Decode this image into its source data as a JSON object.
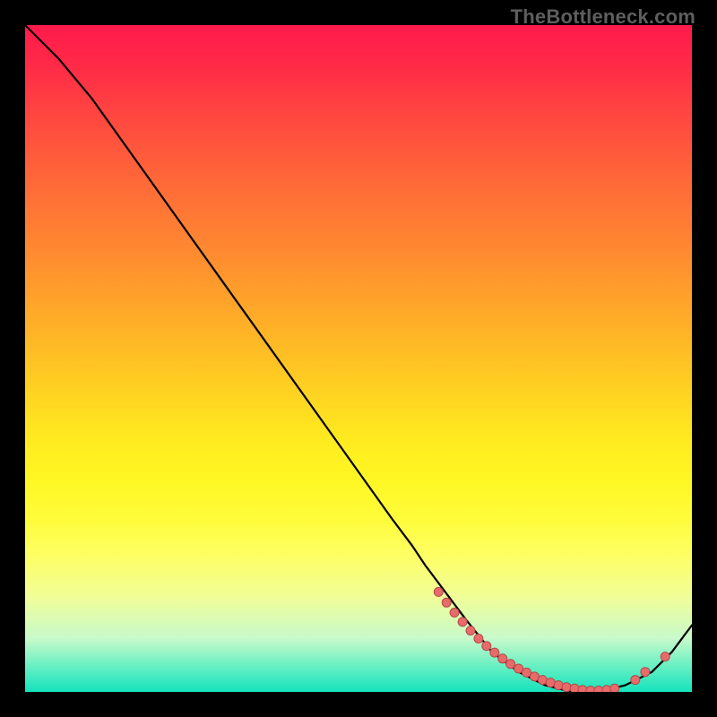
{
  "watermark": {
    "text": "TheBottleneck.com"
  },
  "colors": {
    "background": "#000000",
    "curve_stroke": "#000000",
    "dot_fill": "#e86b6b",
    "dot_stroke": "#b54848"
  },
  "chart_data": {
    "type": "line",
    "title": "",
    "xlabel": "",
    "ylabel": "",
    "xlim": [
      0,
      100
    ],
    "ylim": [
      0,
      100
    ],
    "grid": false,
    "series": [
      {
        "name": "bottleneck-curve",
        "x": [
          0,
          5,
          10,
          15,
          20,
          25,
          30,
          35,
          40,
          45,
          50,
          55,
          58,
          60,
          63,
          66,
          70,
          74,
          78,
          82,
          86,
          90,
          94,
          97,
          100
        ],
        "y": [
          100,
          95,
          89,
          82,
          75,
          68,
          61,
          54,
          47,
          40,
          33,
          26,
          22,
          19,
          15,
          11,
          6,
          3,
          1,
          0,
          0,
          1,
          3,
          6,
          10
        ]
      }
    ],
    "marker_groups": [
      {
        "name": "dense-cluster-left",
        "x": [
          62,
          63.2,
          64.4,
          65.6,
          66.8,
          68,
          69.2,
          70.4,
          71.6,
          72.8,
          74,
          75.2,
          76.4,
          77.6,
          78.8,
          80,
          81.2,
          82.4,
          83.6,
          84.8,
          86,
          87.2,
          88.4
        ],
        "y": [
          15,
          13.4,
          11.9,
          10.5,
          9.2,
          8,
          6.9,
          5.9,
          5.0,
          4.2,
          3.5,
          2.9,
          2.3,
          1.8,
          1.4,
          1.0,
          0.7,
          0.5,
          0.3,
          0.2,
          0.2,
          0.3,
          0.5
        ]
      },
      {
        "name": "points-right",
        "x": [
          91.5,
          93.0,
          96.0
        ],
        "y": [
          1.8,
          3.0,
          5.3
        ]
      }
    ]
  }
}
